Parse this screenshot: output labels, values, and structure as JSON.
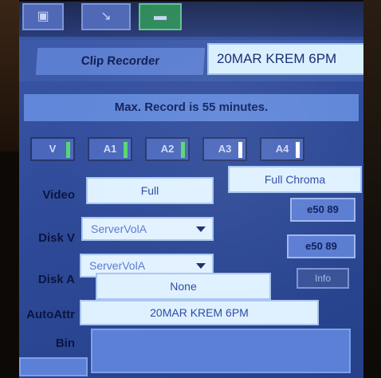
{
  "toolbar": {
    "buttons": [
      {
        "id": "tb1",
        "label": "▣"
      },
      {
        "id": "tb2",
        "label": "↘"
      },
      {
        "id": "tb3",
        "label": "▬"
      }
    ]
  },
  "header": {
    "title": "Clip Recorder",
    "clip_name": "20MAR KREM 6PM"
  },
  "status": {
    "max_record": "Max. Record is 55 minutes."
  },
  "tracks": [
    {
      "label": "V",
      "led": "green"
    },
    {
      "label": "A1",
      "led": "green"
    },
    {
      "label": "A2",
      "led": "green"
    },
    {
      "label": "A3",
      "led": "white"
    },
    {
      "label": "A4",
      "led": "white"
    }
  ],
  "form": {
    "video_label": "Video",
    "video_value": "Full",
    "chroma_value": "Full Chroma",
    "disk_v_label": "Disk V",
    "disk_v_value": "ServerVolA",
    "disk_a_label": "Disk A",
    "disk_a_value": "ServerVolA",
    "time_v": "e50 89",
    "time_a": "e50 89",
    "small_btn": "Info",
    "autoattr_label": "AutoAttr",
    "autoattr_value": "None",
    "bin_label": "Bin",
    "bin_value": "20MAR KREM 6PM"
  },
  "colors": {
    "panel_blue": "#3b58a6",
    "field_light": "#dff1ff",
    "led_green": "#56d76e"
  }
}
